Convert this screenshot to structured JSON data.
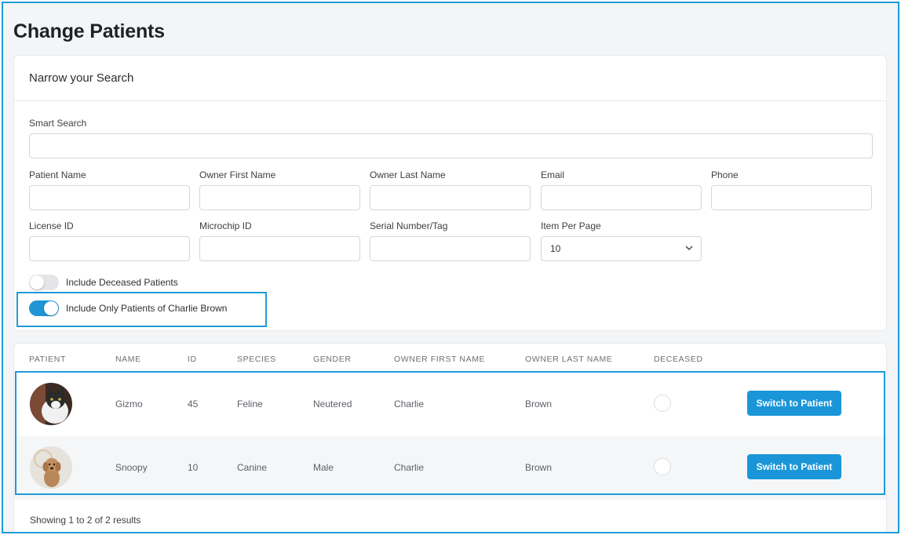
{
  "page": {
    "title": "Change Patients"
  },
  "search": {
    "header": "Narrow your Search",
    "smart_search": {
      "label": "Smart Search",
      "value": ""
    },
    "patient_name": {
      "label": "Patient Name",
      "value": ""
    },
    "owner_first_name": {
      "label": "Owner First Name",
      "value": ""
    },
    "owner_last_name": {
      "label": "Owner Last Name",
      "value": ""
    },
    "email": {
      "label": "Email",
      "value": ""
    },
    "phone": {
      "label": "Phone",
      "value": ""
    },
    "license_id": {
      "label": "License ID",
      "value": ""
    },
    "microchip_id": {
      "label": "Microchip ID",
      "value": ""
    },
    "serial_number": {
      "label": "Serial Number/Tag",
      "value": ""
    },
    "items_per_page": {
      "label": "Item Per Page",
      "value": "10"
    },
    "include_deceased": {
      "label": "Include Deceased Patients",
      "on": false
    },
    "only_owner": {
      "label": "Include Only Patients of Charlie Brown",
      "on": true
    }
  },
  "table": {
    "columns": [
      "PATIENT",
      "NAME",
      "ID",
      "SPECIES",
      "GENDER",
      "OWNER FIRST NAME",
      "OWNER LAST NAME",
      "DECEASED"
    ],
    "rows": [
      {
        "name": "Gizmo",
        "id": "45",
        "species": "Feline",
        "gender": "Neutered",
        "owner_first": "Charlie",
        "owner_last": "Brown",
        "deceased": false,
        "action": "Switch to Patient",
        "avatar": "cat-photo"
      },
      {
        "name": "Snoopy",
        "id": "10",
        "species": "Canine",
        "gender": "Male",
        "owner_first": "Charlie",
        "owner_last": "Brown",
        "deceased": false,
        "action": "Switch to Patient",
        "avatar": "dog-photo"
      }
    ],
    "footer": "Showing 1 to 2 of 2 results"
  },
  "colors": {
    "accent": "#1e9bd7",
    "button": "#1a96d8"
  }
}
